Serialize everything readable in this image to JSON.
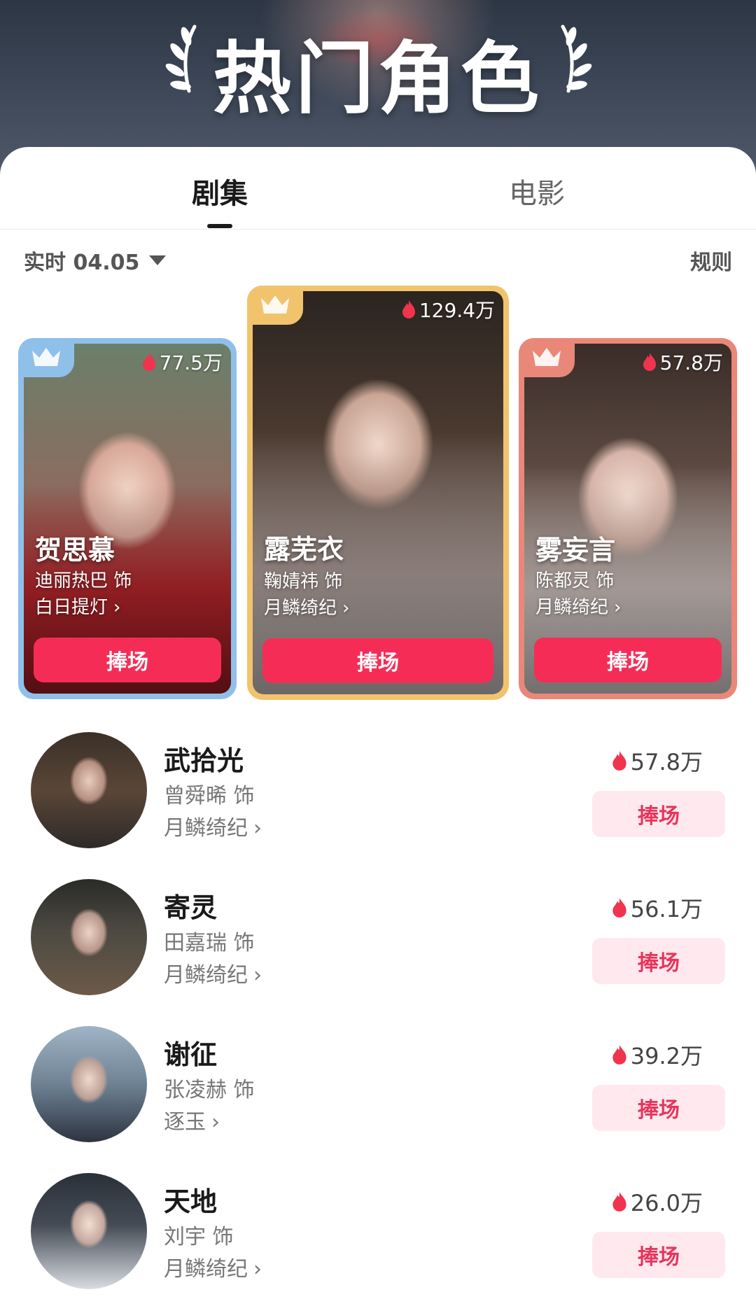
{
  "header": {
    "title": "热门角色"
  },
  "tabs": [
    {
      "label": "剧集",
      "active": true
    },
    {
      "label": "电影",
      "active": false
    }
  ],
  "filter": {
    "label": "实时 04.05"
  },
  "rules_label": "规则",
  "chevron": "›",
  "top3": [
    {
      "name": "贺思慕",
      "actor": "迪丽热巴 饰",
      "show": "白日提灯",
      "heat": "77.5万",
      "button": "捧场",
      "crown_color": "#8fc0ea"
    },
    {
      "name": "露芜衣",
      "actor": "鞠婧祎 饰",
      "show": "月鳞绮纪",
      "heat": "129.4万",
      "button": "捧场",
      "crown_color": "#f1c36c"
    },
    {
      "name": "雾妄言",
      "actor": "陈都灵 饰",
      "show": "月鳞绮纪",
      "heat": "57.8万",
      "button": "捧场",
      "crown_color": "#e98879"
    }
  ],
  "list": [
    {
      "name": "武拾光",
      "actor": "曾舜晞 饰",
      "show": "月鳞绮纪",
      "heat": "57.8万",
      "button": "捧场"
    },
    {
      "name": "寄灵",
      "actor": "田嘉瑞 饰",
      "show": "月鳞绮纪",
      "heat": "56.1万",
      "button": "捧场"
    },
    {
      "name": "谢征",
      "actor": "张凌赫 饰",
      "show": "逐玉",
      "heat": "39.2万",
      "button": "捧场"
    },
    {
      "name": "天地",
      "actor": "刘宇 饰",
      "show": "月鳞绮纪",
      "heat": "26.0万",
      "button": "捧场"
    }
  ],
  "colors": {
    "accent": "#f52d56",
    "button_light_bg": "#ffe9ee",
    "button_light_text": "#e8355c",
    "flame": "#f0344e"
  }
}
